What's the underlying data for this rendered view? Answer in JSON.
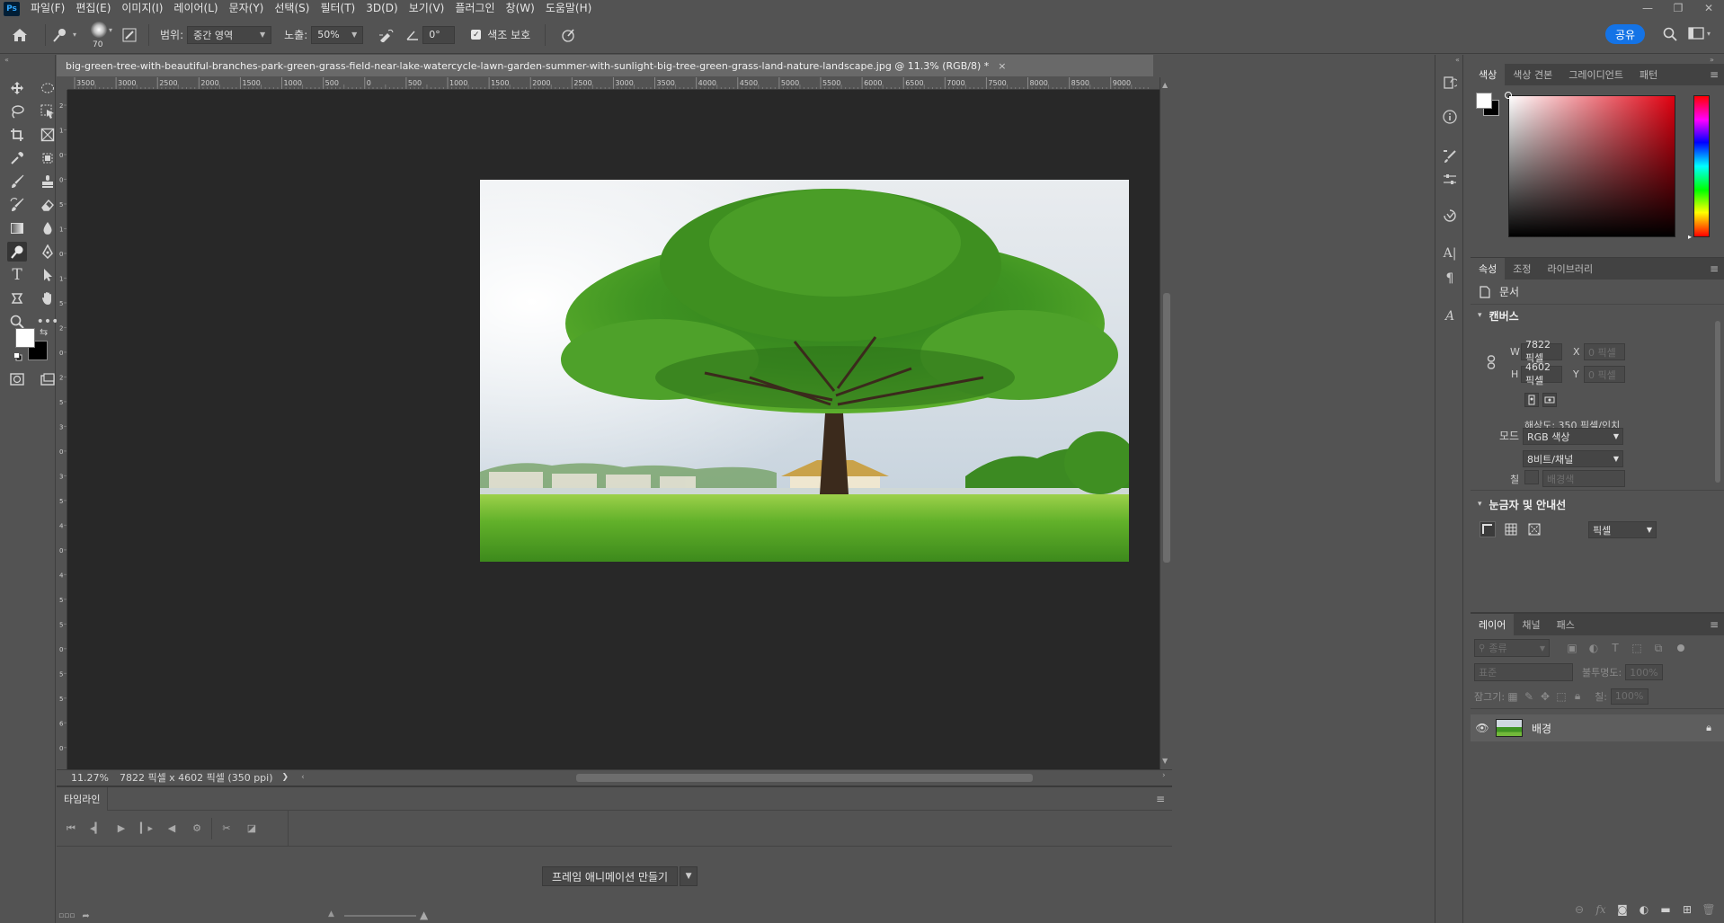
{
  "app": {
    "logo": "Ps"
  },
  "menu": [
    "파일(F)",
    "편집(E)",
    "이미지(I)",
    "레이어(L)",
    "문자(Y)",
    "선택(S)",
    "필터(T)",
    "3D(D)",
    "보기(V)",
    "플러그인",
    "창(W)",
    "도움말(H)"
  ],
  "window_controls": {
    "minimize": "—",
    "restore": "❐",
    "close": "✕"
  },
  "options": {
    "brush_size": "70",
    "range_label": "범위:",
    "range_value": "중간 영역",
    "exposure_label": "노출:",
    "exposure_value": "50%",
    "angle_value": "0°",
    "protect_tones_label": "색조 보호",
    "share_label": "공유"
  },
  "document": {
    "tab_title": "big-green-tree-with-beautiful-branches-park-green-grass-field-near-lake-watercycle-lawn-garden-summer-with-sunlight-big-tree-green-grass-land-nature-landscape.jpg @ 11.3% (RGB/8) *",
    "close_glyph": "×"
  },
  "ruler_top": [
    "3500",
    "3000",
    "2500",
    "2000",
    "1500",
    "1000",
    "500",
    "0",
    "500",
    "1000",
    "1500",
    "2000",
    "2500",
    "3000",
    "3500",
    "4000",
    "4500",
    "5000",
    "5500",
    "6000",
    "6500",
    "7000",
    "7500",
    "8000",
    "8500",
    "9000"
  ],
  "ruler_left": [
    "2",
    "1",
    "0",
    "0",
    "5",
    "1",
    "0",
    "1",
    "5",
    "2",
    "0",
    "2",
    "5",
    "3",
    "0",
    "3",
    "5",
    "4",
    "0",
    "4",
    "5",
    "5",
    "0",
    "5",
    "5",
    "6",
    "0"
  ],
  "status": {
    "zoom": "11.27%",
    "info": "7822 픽셀 x 4602 픽셀 (350 ppi)",
    "arrow": "❯"
  },
  "timeline": {
    "tab_label": "타임라인",
    "create_button": "프레임 애니메이션 만들기"
  },
  "color_panel": {
    "tabs": [
      "색상",
      "색상 견본",
      "그레이디언트",
      "패턴"
    ],
    "active_tab": 0
  },
  "properties_panel": {
    "tabs": [
      "속성",
      "조정",
      "라이브러리"
    ],
    "active_tab": 0,
    "doc_label": "문서",
    "canvas_section": "캔버스",
    "w_label": "W",
    "w_value": "7822 픽셀",
    "h_label": "H",
    "h_value": "4602 픽셀",
    "x_label": "X",
    "x_placeholder": "0 픽셀",
    "y_label": "Y",
    "y_placeholder": "0 픽셀",
    "resolution": "해상도: 350 픽셀/인치",
    "mode_label": "모드",
    "mode_value": "RGB 색상",
    "bits_value": "8비트/채널",
    "fill_label": "칠",
    "fill_value": "배경색",
    "rulers_section": "눈금자 및 안내선",
    "units_value": "픽셀"
  },
  "layers_panel": {
    "tabs": [
      "레이어",
      "채널",
      "패스"
    ],
    "active_tab": 0,
    "filter_placeholder": "종류",
    "blend_mode": "표준",
    "opacity_label": "불투명도:",
    "opacity_value": "100%",
    "lock_label": "잠그기:",
    "fill_label": "칠:",
    "fill_value": "100%",
    "layers": [
      {
        "name": "배경",
        "visible": true,
        "locked": true
      }
    ]
  },
  "colors": {
    "accent": "#1473e6",
    "foreground": "#ffffff",
    "background": "#000000",
    "picker_hue": "#ff0000"
  }
}
